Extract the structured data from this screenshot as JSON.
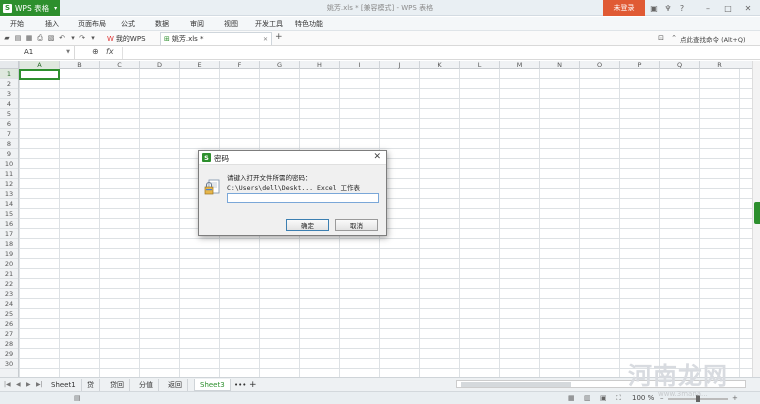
{
  "titlebar": {
    "app_button": "WPS 表格",
    "window_title": "姚芳.xls * [兼容模式] - WPS 表格",
    "login_button": "未登录",
    "colors": {
      "brand": "#2d8f2d",
      "login": "#e05a34"
    }
  },
  "menu": {
    "items": [
      "开始",
      "插入",
      "页面布局",
      "公式",
      "数据",
      "审阅",
      "视图",
      "开发工具",
      "特色功能"
    ]
  },
  "tabs": {
    "items": [
      {
        "label": "我的WPS",
        "icon": "wps-logo-icon",
        "active": false
      },
      {
        "label": "姚芳.xls *",
        "icon": "spreadsheet-icon",
        "active": true
      }
    ],
    "search_hint": "点此查找命令 (Alt+Q)"
  },
  "formula_bar": {
    "cell_ref": "A1",
    "fx": "fx",
    "value": ""
  },
  "grid": {
    "columns": [
      "A",
      "B",
      "C",
      "D",
      "E",
      "F",
      "G",
      "H",
      "I",
      "J",
      "K",
      "L",
      "M",
      "N",
      "O",
      "P",
      "Q",
      "R"
    ],
    "rows": [
      "1",
      "2",
      "3",
      "4",
      "5",
      "6",
      "7",
      "8",
      "9",
      "10",
      "11",
      "12",
      "13",
      "14",
      "15",
      "16",
      "17",
      "18",
      "19",
      "20",
      "21",
      "22",
      "23",
      "24",
      "25",
      "26",
      "27",
      "28",
      "29",
      "30"
    ],
    "active_cell": "A1"
  },
  "sheets": {
    "items": [
      "Sheet1",
      "贷",
      "贷回",
      "分值",
      "返回",
      "Sheet3"
    ],
    "active": "Sheet3",
    "more": "•••",
    "add": "+"
  },
  "status": {
    "zoom": "100 %"
  },
  "dialog": {
    "title": "密码",
    "prompt": "请键入打开文件所需的密码：",
    "path": "C:\\Users\\dell\\Deskt... Excel 工作表 (2).xlsx",
    "password_value": "",
    "ok_label": "确定",
    "cancel_label": "取消"
  },
  "watermark": {
    "text": "河南龙网",
    "url": "www.3mana..."
  }
}
